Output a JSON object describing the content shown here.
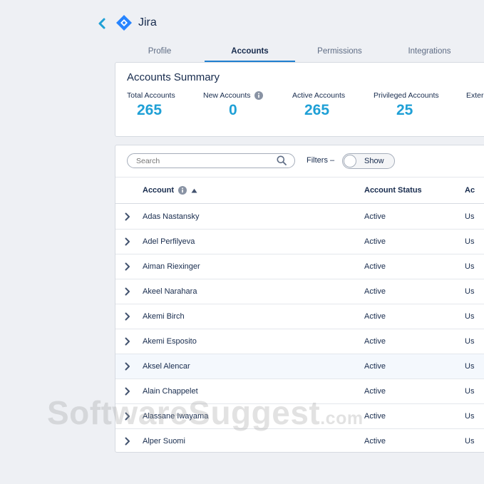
{
  "app": {
    "title": "Jira"
  },
  "tabs": [
    {
      "label": "Profile"
    },
    {
      "label": "Accounts"
    },
    {
      "label": "Permissions"
    },
    {
      "label": "Integrations"
    }
  ],
  "summary": {
    "title": "Accounts Summary",
    "stats": [
      {
        "label": "Total Accounts",
        "value": "265"
      },
      {
        "label": "New Accounts",
        "value": "0"
      },
      {
        "label": "Active Accounts",
        "value": "265"
      },
      {
        "label": "Privileged Accounts",
        "value": "25"
      },
      {
        "label": "Exter"
      }
    ]
  },
  "toolbar": {
    "search_placeholder": "Search",
    "filters_label": "Filters –",
    "toggle_label": "Show"
  },
  "table": {
    "columns": [
      "Account",
      "Account Status",
      "Ac"
    ],
    "rows": [
      {
        "account": "Adas Nastansky",
        "status": "Active",
        "type": "Us"
      },
      {
        "account": "Adel Perfilyeva",
        "status": "Active",
        "type": "Us"
      },
      {
        "account": "Aiman Riexinger",
        "status": "Active",
        "type": "Us"
      },
      {
        "account": "Akeel Narahara",
        "status": "Active",
        "type": "Us"
      },
      {
        "account": "Akemi Birch",
        "status": "Active",
        "type": "Us"
      },
      {
        "account": "Akemi Esposito",
        "status": "Active",
        "type": "Us"
      },
      {
        "account": "Aksel Alencar",
        "status": "Active",
        "type": "Us"
      },
      {
        "account": "Alain Chappelet",
        "status": "Active",
        "type": "Us"
      },
      {
        "account": "Alassane Iwayama",
        "status": "Active",
        "type": "Us"
      },
      {
        "account": "Alper Suomi",
        "status": "Active",
        "type": "Us"
      }
    ]
  },
  "watermark": {
    "text": "SoftwareSuggest",
    "suffix": ".com"
  },
  "colors": {
    "accent": "#1f7fcf",
    "stat_value": "#1fa0d6",
    "logo": "#2684ff"
  }
}
